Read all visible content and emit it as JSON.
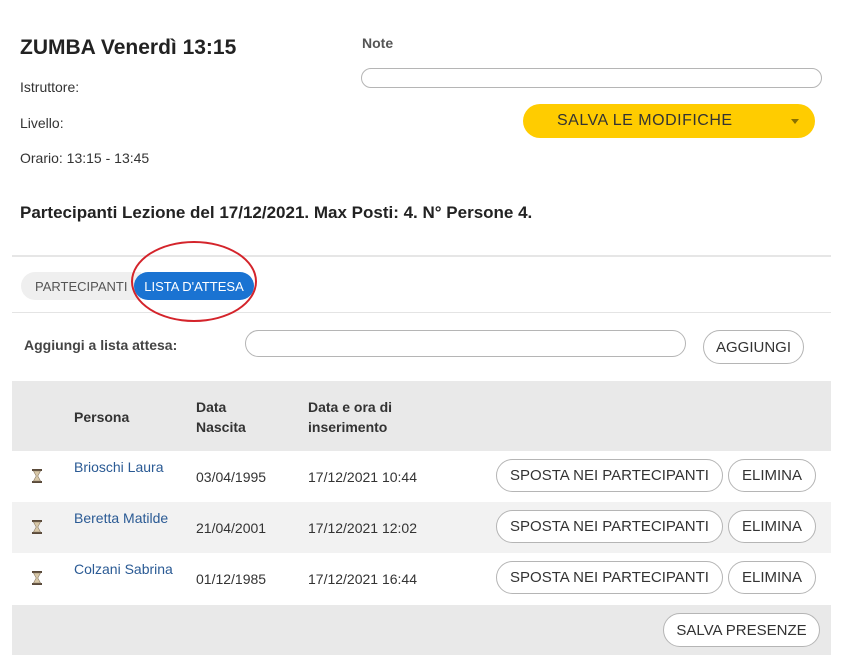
{
  "lesson": {
    "title": "ZUMBA Venerdì 13:15",
    "instructor_label": "Istruttore:",
    "level_label": "Livello:",
    "schedule": "Orario: 13:15 - 13:45"
  },
  "notes": {
    "label": "Note",
    "value": ""
  },
  "save_button": {
    "label": "SALVA LE MODIFICHE",
    "color": "#ffcc00"
  },
  "participants_summary": "Partecipanti Lezione del 17/12/2021. Max Posti: 4. N° Persone 4.",
  "tabs": [
    {
      "label": "PARTECIPANTI",
      "active": false
    },
    {
      "label": "LISTA D'ATTESA",
      "active": true
    }
  ],
  "waitlist_add": {
    "label": "Aggiungi a lista attesa:",
    "value": "",
    "button_label": "AGGIUNGI"
  },
  "table": {
    "headers": {
      "person": "Persona",
      "birth_line1": "Data",
      "birth_line2": "Nascita",
      "inserted_line1": "Data e ora di",
      "inserted_line2": "inserimento"
    },
    "rows": [
      {
        "person": "Brioschi Laura",
        "birth": "03/04/1995",
        "inserted": "17/12/2021 10:44",
        "icon": "hourglass-icon"
      },
      {
        "person": "Beretta Matilde",
        "birth": "21/04/2001",
        "inserted": "17/12/2021 12:02",
        "icon": "hourglass-icon"
      },
      {
        "person": "Colzani Sabrina",
        "birth": "01/12/1985",
        "inserted": "17/12/2021 16:44",
        "icon": "hourglass-icon"
      }
    ],
    "move_label": "SPOSTA NEI PARTECIPANTI",
    "delete_label": "ELIMINA"
  },
  "footer": {
    "save_attendance_label": "SALVA PRESENZE"
  },
  "colors": {
    "accent_blue": "#1a73d2",
    "highlight_red": "#d4242b",
    "link": "#2a5a94"
  }
}
